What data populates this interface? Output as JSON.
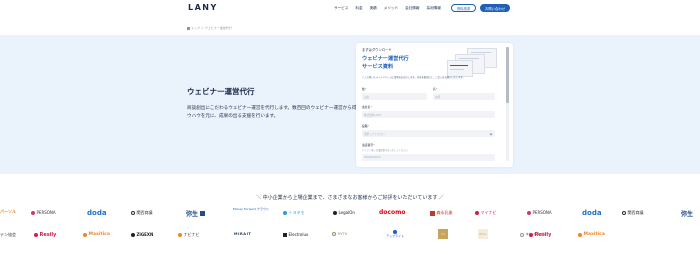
{
  "header": {
    "logo": "LANY",
    "nav": [
      "サービス",
      "料金",
      "実績",
      "メソッド",
      "会社情報",
      "採用情報"
    ],
    "doc_button": "資料請求",
    "contact_button": "お問い合わせ"
  },
  "breadcrumb": {
    "text": "トップ ＞ ウェビナー運営代行"
  },
  "hero": {
    "title": "ウェビナー運営代行",
    "description": "商談創出にこだわるウェビナー運営を代行します。数百回のウェビナー運営から得たノウハウを元に、成果の出る支援を行います。"
  },
  "form": {
    "kicker": "まずはダウンロード",
    "title_line1": "ウェビナー運営代行",
    "title_line2": "サービス資料",
    "note": "ご入力頂いたメールアドレスに資料をお送りします。内容を確認の上、ご記入をお願いいたします。",
    "last_name_label": "姓",
    "last_name_placeholder": "山田",
    "first_name_label": "名",
    "first_name_placeholder": "太郎",
    "company_label": "会社名",
    "company_placeholder": "株式会社LANY",
    "role_label": "役職",
    "role_placeholder": "選択してください",
    "email_label": "電話番号",
    "email_hint": "ハイフン無しの電話番号を入力してください",
    "email_placeholder": "0000000000",
    "required_mark": "*"
  },
  "trust": {
    "heading": "＼ 中小企業から上場企業まで、さまざまなお客様からご好評をいただいています ／"
  },
  "logos_row1": [
    "パーソル",
    "PERSONA",
    "doda",
    "関西商議",
    "弥生",
    "Money Forward クラウド",
    "トヨタモ",
    "LegalOn",
    "docomo",
    "森永乳業",
    "マイナビ",
    "PERSONA",
    "doda",
    "関西商議",
    "弥生"
  ],
  "logos_row2": [
    "テン協会",
    "Resily",
    "Maxitica",
    "ZIGEXN",
    "ナビナビ",
    "MIRAIT",
    "Electrolux",
    "MYTH",
    "ネクスト",
    "ロゴ",
    "アップライト",
    "キレイライン",
    "Resily",
    "Maxitica"
  ],
  "colors": {
    "accent": "#1e5fb8",
    "hero_bg": "#eaf2fb",
    "text": "#1a2b4a",
    "docomo": "#e60012",
    "doda": "#1e6fd1"
  }
}
